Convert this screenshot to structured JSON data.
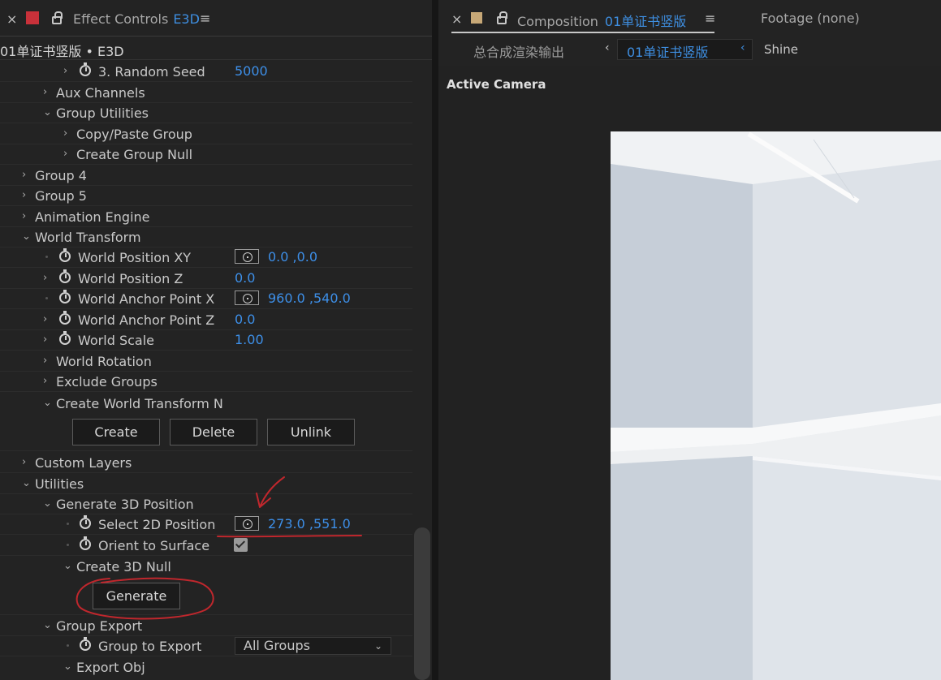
{
  "left_panel": {
    "tab_title": "Effect Controls",
    "tab_accent": "E3D",
    "layer_path": "01单证书竖版 • E3D",
    "tree": [
      {
        "label": "3. Random Seed",
        "value": "5000"
      },
      {
        "label": "Aux Channels"
      },
      {
        "label": "Group Utilities"
      },
      {
        "label": "Copy/Paste Group"
      },
      {
        "label": "Create Group Null"
      },
      {
        "label": "Group 4"
      },
      {
        "label": "Group 5"
      },
      {
        "label": "Animation Engine"
      },
      {
        "label": "World Transform"
      },
      {
        "label": "World Position XY",
        "value": "0.0 ,0.0"
      },
      {
        "label": "World Position Z",
        "value": "0.0"
      },
      {
        "label": "World Anchor Point X",
        "value": "960.0 ,540.0"
      },
      {
        "label": "World Anchor Point Z",
        "value": "0.0"
      },
      {
        "label": "World Scale",
        "value": "1.00"
      },
      {
        "label": "World Rotation"
      },
      {
        "label": "Exclude Groups"
      },
      {
        "label": "Create World Transform N"
      },
      {
        "label": "Custom Layers"
      },
      {
        "label": "Utilities"
      },
      {
        "label": "Generate 3D Position"
      },
      {
        "label": "Select 2D Position",
        "value": "273.0 ,551.0"
      },
      {
        "label": "Orient to Surface"
      },
      {
        "label": "Create 3D Null"
      },
      {
        "label": "Group Export"
      },
      {
        "label": "Group to Export"
      },
      {
        "label": "Export Obj"
      }
    ],
    "buttons": {
      "create": "Create",
      "delete": "Delete",
      "unlink": "Unlink",
      "generate": "Generate"
    },
    "dropdown_value": "All Groups",
    "orient_checked": true
  },
  "right_panel": {
    "tab_label": "Composition",
    "tab_accent": "01单证书竖版",
    "footage": "Footage  (none)",
    "breadcrumb": [
      "总合成渲染输出",
      "01单证书竖版",
      "Shine"
    ],
    "viewer_label": "Active Camera"
  },
  "icons": {
    "close": "×",
    "menu": "≡",
    "chevron_right": "›",
    "chevron_down": "⌄",
    "chevron_left": "‹"
  },
  "colors": {
    "accent": "#3e8ee0",
    "annotation": "#c0272d"
  }
}
